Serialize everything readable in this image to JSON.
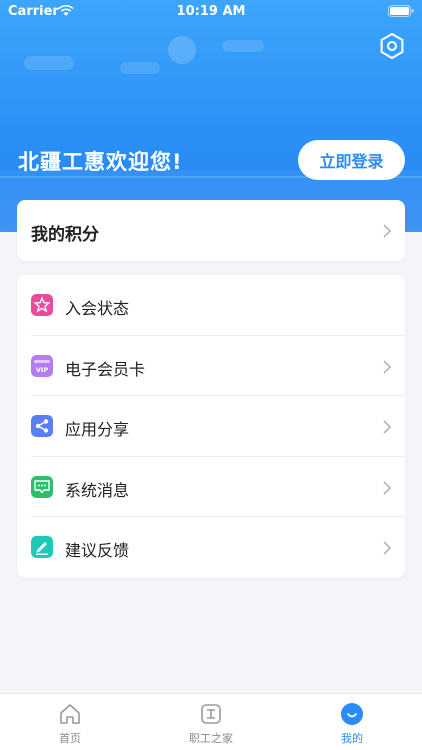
{
  "status_bar": {
    "carrier": "Carrier",
    "time": "10:19 AM"
  },
  "header": {
    "welcome": "北疆工惠欢迎您!",
    "login_label": "立即登录"
  },
  "points": {
    "label": "我的积分"
  },
  "menu": {
    "items": [
      {
        "label": "入会状态",
        "icon": "membership-status-icon",
        "color": "#e84c9a",
        "has_chevron": false
      },
      {
        "label": "电子会员卡",
        "icon": "vip-card-icon",
        "color": "#b57cf0",
        "has_chevron": true
      },
      {
        "label": "应用分享",
        "icon": "share-icon",
        "color": "#5a7ff0",
        "has_chevron": true
      },
      {
        "label": "系统消息",
        "icon": "message-icon",
        "color": "#2fbf6c",
        "has_chevron": true
      },
      {
        "label": "建议反馈",
        "icon": "feedback-edit-icon",
        "color": "#1ec9b7",
        "has_chevron": true
      }
    ]
  },
  "tabbar": {
    "tabs": [
      {
        "label": "首页",
        "icon": "home-icon"
      },
      {
        "label": "职工之家",
        "icon": "workers-home-icon"
      },
      {
        "label": "我的",
        "icon": "profile-icon",
        "active": true
      }
    ]
  },
  "colors": {
    "accent": "#2b8cf5",
    "hero_top": "#3da5fa",
    "hero_bottom": "#2585f3"
  }
}
